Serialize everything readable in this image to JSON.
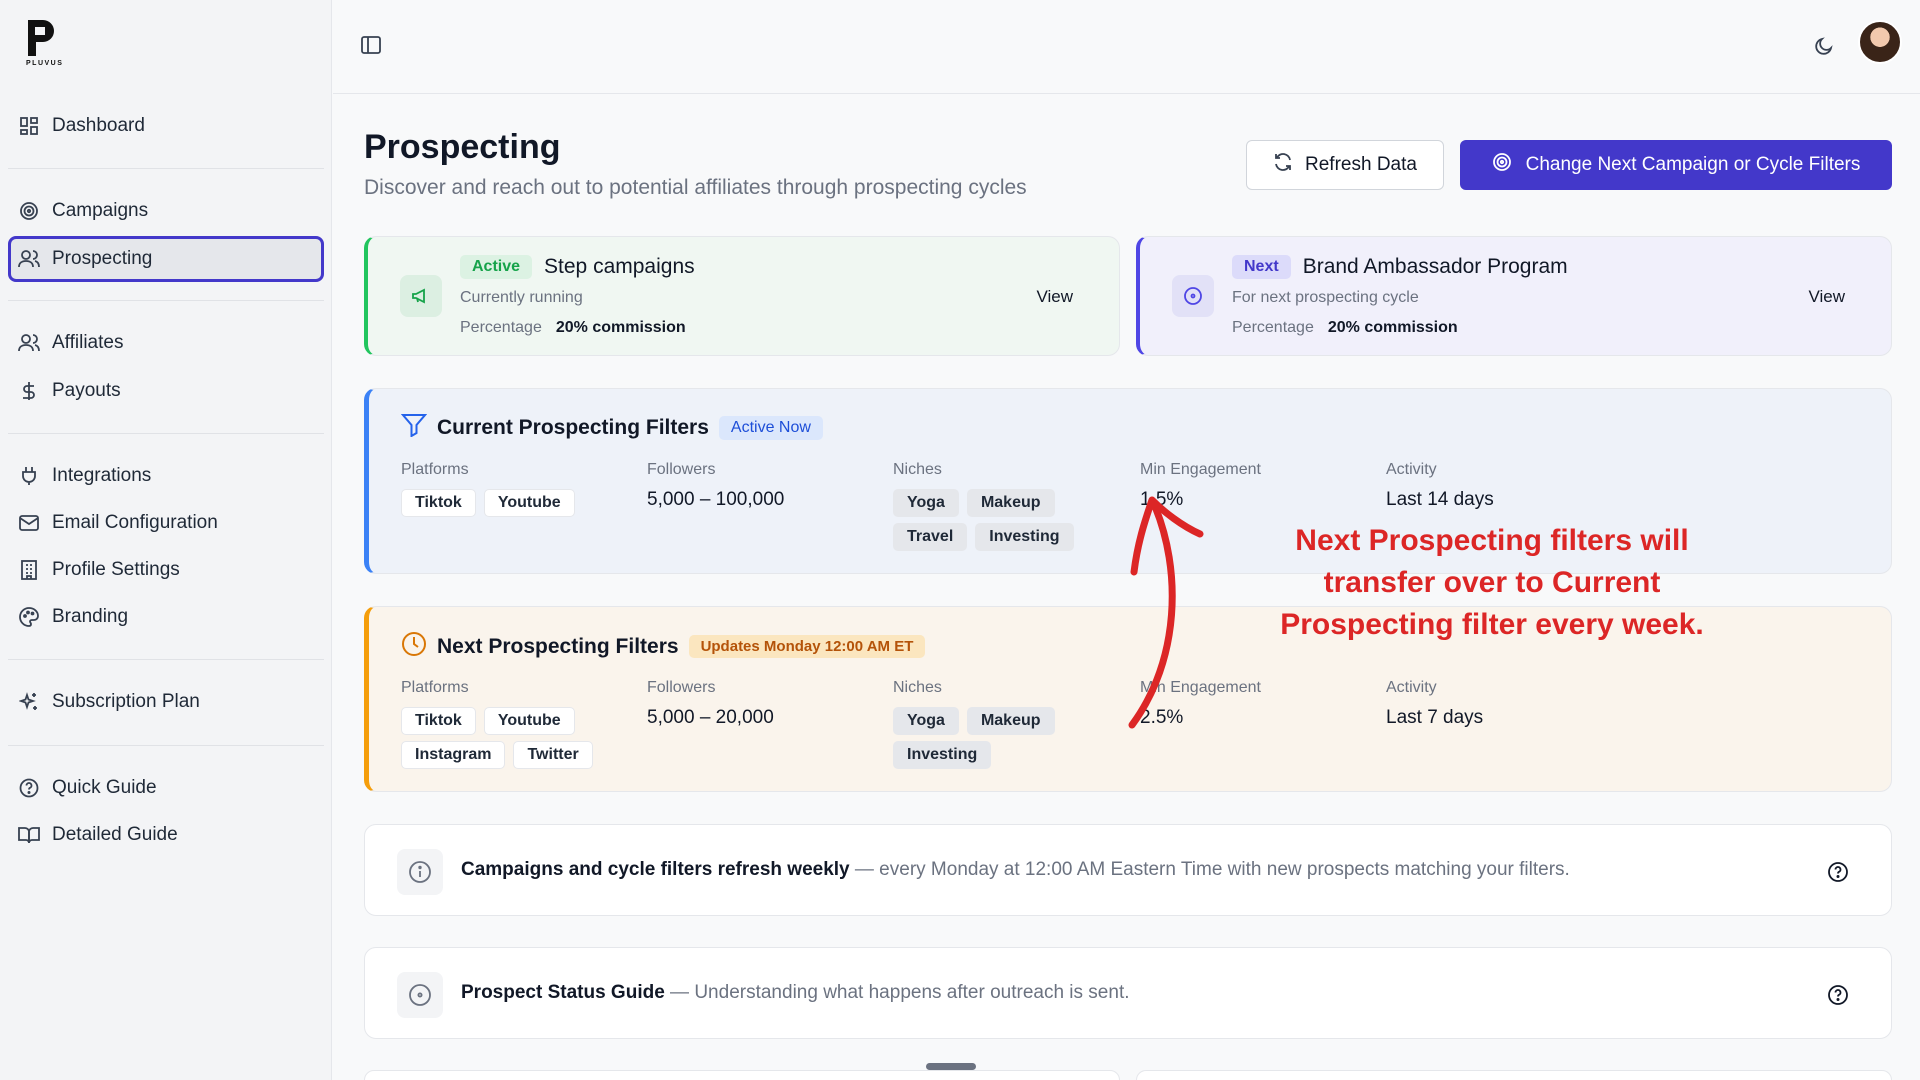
{
  "brand": {
    "logo_text": "PLUVUS"
  },
  "sidebar": {
    "items": [
      {
        "label": "Dashboard",
        "icon": "dashboard-icon"
      },
      {
        "label": "Campaigns",
        "icon": "target-icon"
      },
      {
        "label": "Prospecting",
        "icon": "users-icon",
        "active": true
      },
      {
        "label": "Affiliates",
        "icon": "users-icon"
      },
      {
        "label": "Payouts",
        "icon": "dollar-icon"
      },
      {
        "label": "Integrations",
        "icon": "plug-icon"
      },
      {
        "label": "Email Configuration",
        "icon": "mail-icon"
      },
      {
        "label": "Profile Settings",
        "icon": "building-icon"
      },
      {
        "label": "Branding",
        "icon": "palette-icon"
      },
      {
        "label": "Subscription Plan",
        "icon": "sparkles-icon"
      },
      {
        "label": "Quick Guide",
        "icon": "help-circle-icon"
      },
      {
        "label": "Detailed Guide",
        "icon": "book-icon"
      }
    ]
  },
  "header": {
    "title": "Prospecting",
    "subtitle": "Discover and reach out to potential affiliates through prospecting cycles",
    "refresh_label": "Refresh Data",
    "change_label": "Change Next Campaign or Cycle Filters"
  },
  "campaigns": {
    "active": {
      "badge": "Active",
      "name": "Step campaigns",
      "sub": "Currently running",
      "pct_label": "Percentage",
      "pct_value": "20% commission",
      "view": "View"
    },
    "next": {
      "badge": "Next",
      "name": "Brand Ambassador Program",
      "sub": "For next prospecting cycle",
      "pct_label": "Percentage",
      "pct_value": "20% commission",
      "view": "View"
    }
  },
  "filters": {
    "current": {
      "title": "Current Prospecting Filters",
      "badge": "Active Now",
      "platforms_label": "Platforms",
      "platforms": [
        "Tiktok",
        "Youtube"
      ],
      "followers_label": "Followers",
      "followers": "5,000 – 100,000",
      "niches_label": "Niches",
      "niches": [
        "Yoga",
        "Makeup",
        "Travel",
        "Investing"
      ],
      "engagement_label": "Min Engagement",
      "engagement": "1.5%",
      "activity_label": "Activity",
      "activity": "Last 14 days"
    },
    "next": {
      "title": "Next Prospecting Filters",
      "badge": "Updates Monday 12:00 AM ET",
      "platforms_label": "Platforms",
      "platforms": [
        "Tiktok",
        "Youtube",
        "Instagram",
        "Twitter"
      ],
      "followers_label": "Followers",
      "followers": "5,000 – 20,000",
      "niches_label": "Niches",
      "niches": [
        "Yoga",
        "Makeup",
        "Investing"
      ],
      "engagement_label": "Min Engagement",
      "engagement": "2.5%",
      "activity_label": "Activity",
      "activity": "Last 7 days"
    }
  },
  "info": {
    "refresh": {
      "bold": "Campaigns and cycle filters refresh weekly",
      "rest": " — every Monday at 12:00 AM Eastern Time with new prospects matching your filters."
    },
    "status": {
      "bold": "Prospect Status Guide",
      "rest": " — Understanding what happens after outreach is sent."
    }
  },
  "annotation": "Next Prospecting filters will transfer over to Current Prospecting filter every week.",
  "colors": {
    "accent": "#4338ca",
    "active_green": "#22c55e",
    "current_blue": "#3b82f6",
    "next_amber": "#f59e0b",
    "annotation_red": "#dc2626"
  }
}
